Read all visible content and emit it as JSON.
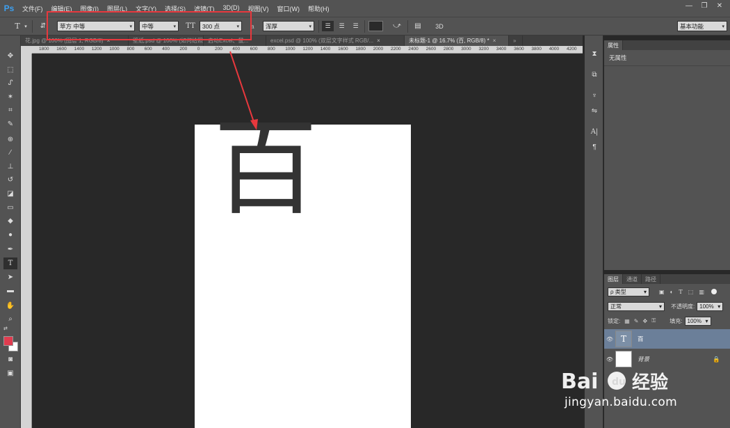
{
  "app": {
    "logo": "Ps"
  },
  "menu": [
    "文件(F)",
    "编辑(E)",
    "图像(I)",
    "图层(L)",
    "文字(Y)",
    "选择(S)",
    "滤镜(T)",
    "3D(D)",
    "视图(V)",
    "窗口(W)",
    "帮助(H)"
  ],
  "window_controls": [
    "—",
    "❐",
    "✕"
  ],
  "options": {
    "font_family": "苹方 中等",
    "font_style": "中等",
    "font_size": "300 点",
    "aa_label": "a",
    "antialias": "浑厚",
    "workspace": "基本功能",
    "three_d": "3D"
  },
  "tabs": [
    {
      "label": "花.jpg @ 100% (图层 1, RGB/8)",
      "close": "×"
    },
    {
      "label": "壁纸.psd @ 100% (如何给照片...",
      "close": "×"
    },
    {
      "label": "启动Excel、鼠...",
      "close": ""
    },
    {
      "label": "excel.psd @ 100% (双层文字样式 RGB/...",
      "close": "×"
    },
    {
      "label": "未标题-1 @ 16.7% (百, RGB/8) *",
      "close": "×"
    }
  ],
  "ruler_h": [
    "1800",
    "1600",
    "1400",
    "1200",
    "1000",
    "800",
    "600",
    "400",
    "200",
    "0",
    "200",
    "400",
    "600",
    "800",
    "1000",
    "1200",
    "1400",
    "1600",
    "1800",
    "2000",
    "2200",
    "2400",
    "2600",
    "2800",
    "3000",
    "3200",
    "3400",
    "3600",
    "3800",
    "4000",
    "4200"
  ],
  "canvas": {
    "glyph": "百"
  },
  "properties": {
    "tab": "属性",
    "label": "无属性"
  },
  "layers": {
    "tabs": [
      "图层",
      "通道",
      "路径"
    ],
    "filter": "ρ 类型",
    "blend": "正常",
    "opacity_label": "不透明度:",
    "opacity": "100%",
    "lock_label": "锁定:",
    "fill_label": "填充:",
    "fill": "100%",
    "items": [
      {
        "name": "百",
        "thumb": "T",
        "selected": true
      },
      {
        "name": "背景",
        "thumb": "",
        "selected": false
      }
    ]
  },
  "watermark": {
    "brand": "Bai du 经验",
    "url": "jingyan.baidu.com"
  },
  "colors": {
    "foreground": "#e03c4f",
    "background": "#ffffff",
    "highlight": "#e8383d",
    "selected_layer": "#6b7f99"
  }
}
